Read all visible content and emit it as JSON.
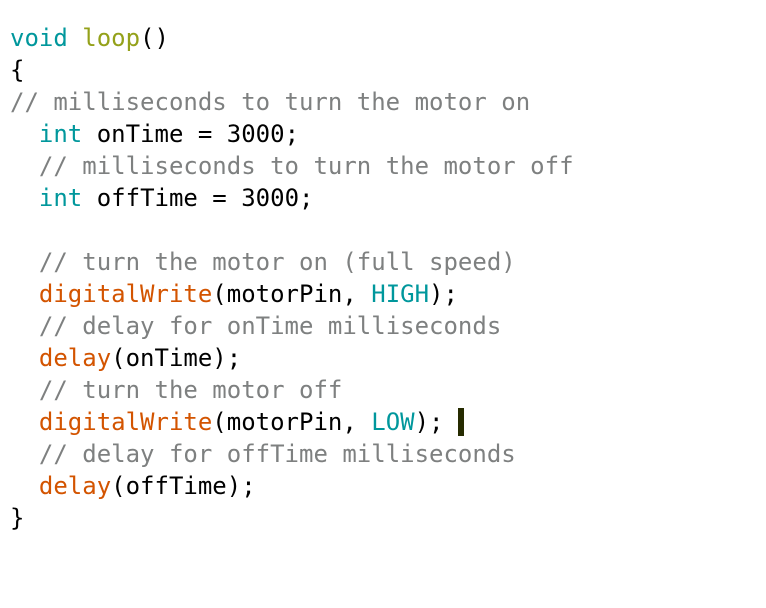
{
  "editor": {
    "name": "arduino-code-view",
    "background": "#ffffff",
    "font_size_px": 24,
    "line_height_px": 32,
    "colors": {
      "plain": "#000000",
      "keyword": "#00979c",
      "function": "#d35400",
      "identifier": "#94a11a",
      "comment": "#7e8080",
      "caret": "#262b00"
    },
    "caret": {
      "visible": true,
      "after_line_index": 10
    }
  },
  "code": {
    "lines": [
      {
        "index": 0,
        "name": "line-void-loop",
        "tokens": [
          {
            "text": "void",
            "type": "keyword"
          },
          {
            "text": " ",
            "type": "plain"
          },
          {
            "text": "loop",
            "type": "ident"
          },
          {
            "text": "()",
            "type": "plain"
          }
        ]
      },
      {
        "index": 1,
        "name": "line-open-brace",
        "tokens": [
          {
            "text": "{",
            "type": "plain"
          }
        ]
      },
      {
        "index": 2,
        "name": "line-comment-ontime",
        "tokens": [
          {
            "text": "// milliseconds to turn the motor on",
            "type": "comment"
          }
        ]
      },
      {
        "index": 3,
        "name": "line-int-ontime",
        "tokens": [
          {
            "text": "  ",
            "type": "plain"
          },
          {
            "text": "int",
            "type": "keyword"
          },
          {
            "text": " onTime = ",
            "type": "plain"
          },
          {
            "text": "3000",
            "type": "number"
          },
          {
            "text": ";",
            "type": "plain"
          }
        ]
      },
      {
        "index": 4,
        "name": "line-comment-offtime",
        "tokens": [
          {
            "text": "  ",
            "type": "plain"
          },
          {
            "text": "// milliseconds to turn the motor off",
            "type": "comment"
          }
        ]
      },
      {
        "index": 5,
        "name": "line-int-offtime",
        "tokens": [
          {
            "text": "  ",
            "type": "plain"
          },
          {
            "text": "int",
            "type": "keyword"
          },
          {
            "text": " offTime = ",
            "type": "plain"
          },
          {
            "text": "3000",
            "type": "number"
          },
          {
            "text": ";",
            "type": "plain"
          }
        ]
      },
      {
        "index": 6,
        "name": "line-blank",
        "tokens": []
      },
      {
        "index": 7,
        "name": "line-comment-turn-on",
        "tokens": [
          {
            "text": "  ",
            "type": "plain"
          },
          {
            "text": "// turn the motor on (full speed)",
            "type": "comment"
          }
        ]
      },
      {
        "index": 8,
        "name": "line-digitalwrite-high",
        "tokens": [
          {
            "text": "  ",
            "type": "plain"
          },
          {
            "text": "digitalWrite",
            "type": "function"
          },
          {
            "text": "(motorPin, ",
            "type": "plain"
          },
          {
            "text": "HIGH",
            "type": "keyword"
          },
          {
            "text": ");",
            "type": "plain"
          }
        ]
      },
      {
        "index": 9,
        "name": "line-comment-delay-ontime",
        "tokens": [
          {
            "text": "  ",
            "type": "plain"
          },
          {
            "text": "// delay for onTime milliseconds",
            "type": "comment"
          }
        ]
      },
      {
        "index": 10,
        "name": "line-delay-ontime",
        "tokens": [
          {
            "text": "  ",
            "type": "plain"
          },
          {
            "text": "delay",
            "type": "function"
          },
          {
            "text": "(onTime);",
            "type": "plain"
          }
        ]
      },
      {
        "index": 11,
        "name": "line-comment-turn-off",
        "tokens": [
          {
            "text": "  ",
            "type": "plain"
          },
          {
            "text": "// turn the motor off",
            "type": "comment"
          }
        ]
      },
      {
        "index": 12,
        "name": "line-digitalwrite-low",
        "caret": true,
        "tokens": [
          {
            "text": "  ",
            "type": "plain"
          },
          {
            "text": "digitalWrite",
            "type": "function"
          },
          {
            "text": "(motorPin, ",
            "type": "plain"
          },
          {
            "text": "LOW",
            "type": "keyword"
          },
          {
            "text": ");",
            "type": "plain"
          }
        ]
      },
      {
        "index": 13,
        "name": "line-comment-delay-offtime",
        "tokens": [
          {
            "text": "  ",
            "type": "plain"
          },
          {
            "text": "// delay for offTime milliseconds",
            "type": "comment"
          }
        ]
      },
      {
        "index": 14,
        "name": "line-delay-offtime",
        "tokens": [
          {
            "text": "  ",
            "type": "plain"
          },
          {
            "text": "delay",
            "type": "function"
          },
          {
            "text": "(offTime);",
            "type": "plain"
          }
        ]
      },
      {
        "index": 15,
        "name": "line-close-brace",
        "tokens": [
          {
            "text": "}",
            "type": "plain"
          }
        ]
      }
    ]
  }
}
